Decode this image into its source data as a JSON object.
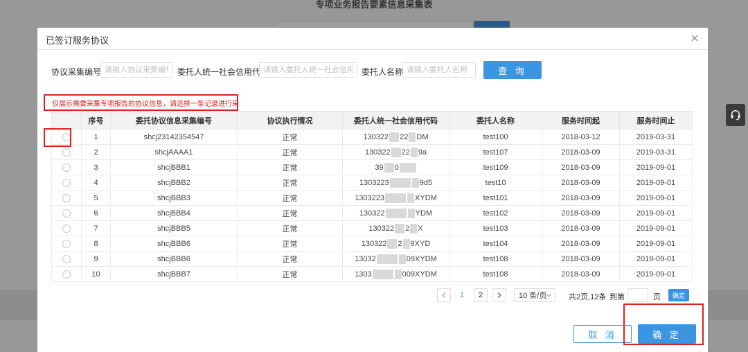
{
  "background": {
    "title": "专项业务报告要素信息采集表"
  },
  "modal": {
    "title": "已签订服务协议",
    "close_icon": "close-icon"
  },
  "filters": {
    "agreement_no_label": "协议采集编号:",
    "agreement_no_placeholder": "请输入协议采集编号",
    "credit_code_label": "委托人统一社会信用代码:",
    "credit_code_placeholder": "请输入委托人统一社会信用代",
    "client_name_label": "委托人名称:",
    "client_name_placeholder": "请输入委托人名称",
    "query_button": "查 询"
  },
  "notice": "仅展示需要采集专项报告的协议信息，请选择一条记录进行采集!",
  "table": {
    "headers": [
      "",
      "序号",
      "委托协议信息采集编号",
      "协议执行情况",
      "委托人统一社会信用代码",
      "委托人名称",
      "服务时间起",
      "服务时间止"
    ],
    "rows": [
      {
        "no": "1",
        "code": "shcj23142354547",
        "status": "正常",
        "credit_a": "130322",
        "credit_b": "22",
        "credit_c": "DM",
        "name": "test100",
        "start": "2018-03-12",
        "end": "2019-03-31"
      },
      {
        "no": "2",
        "code": "shcjAAAA1",
        "status": "正常",
        "credit_a": "130322",
        "credit_b": "22",
        "credit_c": "9a",
        "name": "test107",
        "start": "2018-03-09",
        "end": "2019-03-31"
      },
      {
        "no": "3",
        "code": "shcjBBB1",
        "status": "正常",
        "credit_a": "39",
        "credit_b": "0",
        "credit_c": "",
        "name": "test109",
        "start": "2018-03-09",
        "end": "2019-09-01"
      },
      {
        "no": "4",
        "code": "shcjBBB2",
        "status": "正常",
        "credit_a": "1303223",
        "credit_b": "",
        "credit_c": "9d5",
        "name": "test10",
        "start": "2018-03-09",
        "end": "2019-09-01"
      },
      {
        "no": "5",
        "code": "shcjBBB3",
        "status": "正常",
        "credit_a": "1303223",
        "credit_b": "",
        "credit_c": "XYDM",
        "name": "test101",
        "start": "2018-03-09",
        "end": "2019-09-01"
      },
      {
        "no": "6",
        "code": "shcjBBB4",
        "status": "正常",
        "credit_a": "130322",
        "credit_b": "",
        "credit_c": "YDM",
        "name": "test102",
        "start": "2018-03-09",
        "end": "2019-09-01"
      },
      {
        "no": "7",
        "code": "shcjBBB5",
        "status": "正常",
        "credit_a": "130322",
        "credit_b": "2",
        "credit_c": "X",
        "name": "test103",
        "start": "2018-03-09",
        "end": "2019-09-01"
      },
      {
        "no": "8",
        "code": "shcjBBB6",
        "status": "正常",
        "credit_a": "130322",
        "credit_b": "2",
        "credit_c": "9XYD",
        "name": "test104",
        "start": "2018-03-09",
        "end": "2019-09-01"
      },
      {
        "no": "9",
        "code": "shcjBBB6",
        "status": "正常",
        "credit_a": "13032",
        "credit_b": "",
        "credit_c": "09XYDM",
        "name": "test108",
        "start": "2018-03-09",
        "end": "2019-09-01"
      },
      {
        "no": "10",
        "code": "shcjBBB7",
        "status": "正常",
        "credit_a": "1303",
        "credit_b": "",
        "credit_c": "009XYDM",
        "name": "test108",
        "start": "2018-03-09",
        "end": "2019-09-01"
      }
    ]
  },
  "pagination": {
    "prev_icon": "chevron-left-icon",
    "pages": [
      "1",
      "2"
    ],
    "current_page": "1",
    "next_icon": "chevron-right-icon",
    "page_size": "10 条/页",
    "summary": "共2页,12条",
    "goto_label": "到第",
    "goto_value": "",
    "page_unit": "页",
    "confirm_label": "确定"
  },
  "footer": {
    "cancel_button": "取 消",
    "ok_button": "确 定"
  },
  "colors": {
    "primary": "#3a95e3",
    "highlight_red": "#e02020",
    "overlay": "rgba(0,0,0,0.38)"
  }
}
